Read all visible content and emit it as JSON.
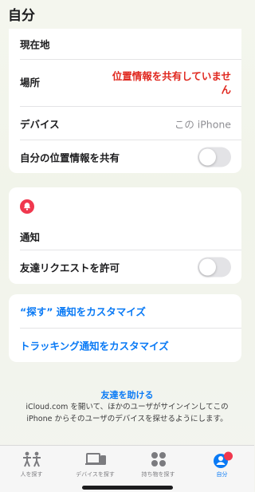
{
  "header": {
    "title": "自分"
  },
  "location_card": {
    "current_location_label": "現在地",
    "place_label": "場所",
    "place_value": "位置情報を共有していません",
    "device_label": "デバイス",
    "device_value": "この iPhone",
    "share_label": "自分の位置情報を共有",
    "share_enabled": false
  },
  "notify_card": {
    "title": "通知",
    "friend_request_label": "友達リクエストを許可",
    "friend_request_enabled": false
  },
  "links": {
    "customize_find": "“探す” 通知をカスタマイズ",
    "customize_tracking": "トラッキング通知をカスタマイズ"
  },
  "help": {
    "title": "友達を助ける",
    "body": "iCloud.com を開いて、ほかのユーザがサインインしてこの iPhone からそのユーザのデバイスを探せるようにします。"
  },
  "tabs": [
    {
      "label": "人を探す",
      "icon": "people-icon"
    },
    {
      "label": "デバイスを探す",
      "icon": "devices-icon"
    },
    {
      "label": "持ち物を探す",
      "icon": "items-icon"
    },
    {
      "label": "自分",
      "icon": "me-icon",
      "active": true
    }
  ],
  "colors": {
    "accent": "#0a7af5",
    "warning": "#e0281f",
    "notify_icon": "#f0384e"
  }
}
